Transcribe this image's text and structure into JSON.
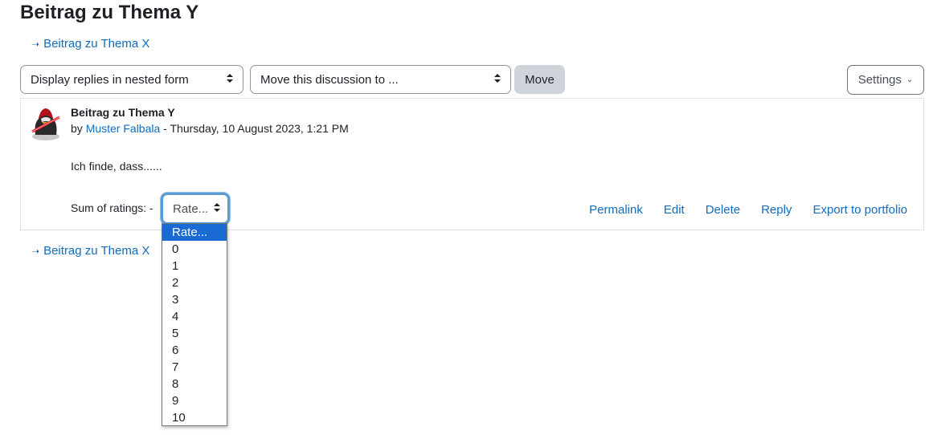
{
  "page": {
    "title": "Beitrag zu Thema Y"
  },
  "navigation": {
    "prev_arrow": "⭲",
    "prev_link_top": "Beitrag zu Thema X",
    "prev_link_bottom": "Beitrag zu Thema X"
  },
  "toolbar": {
    "display_mode_select": "Display replies in nested form",
    "move_select": "Move this discussion to ...",
    "move_button": "Move",
    "settings_button": "Settings"
  },
  "post": {
    "subject": "Beitrag zu Thema Y",
    "by_prefix": "by",
    "author": "Muster Falbala",
    "date_separator": " - ",
    "date": "Thursday, 10 August 2023, 1:21 PM",
    "body": "Ich finde, dass......",
    "rating_label": "Sum of ratings: -",
    "rate_select_value": "Rate...",
    "actions": [
      "Permalink",
      "Edit",
      "Delete",
      "Reply",
      "Export to portfolio"
    ]
  },
  "rating_dropdown": {
    "selected": "Rate...",
    "options": [
      "Rate...",
      "0",
      "1",
      "2",
      "3",
      "4",
      "5",
      "6",
      "7",
      "8",
      "9",
      "10"
    ]
  },
  "colors": {
    "link": "#0f6cbf",
    "selected_option": "#1a6ad4",
    "focus_ring": "#5b9bd5",
    "move_button_bg": "#ced4da"
  }
}
